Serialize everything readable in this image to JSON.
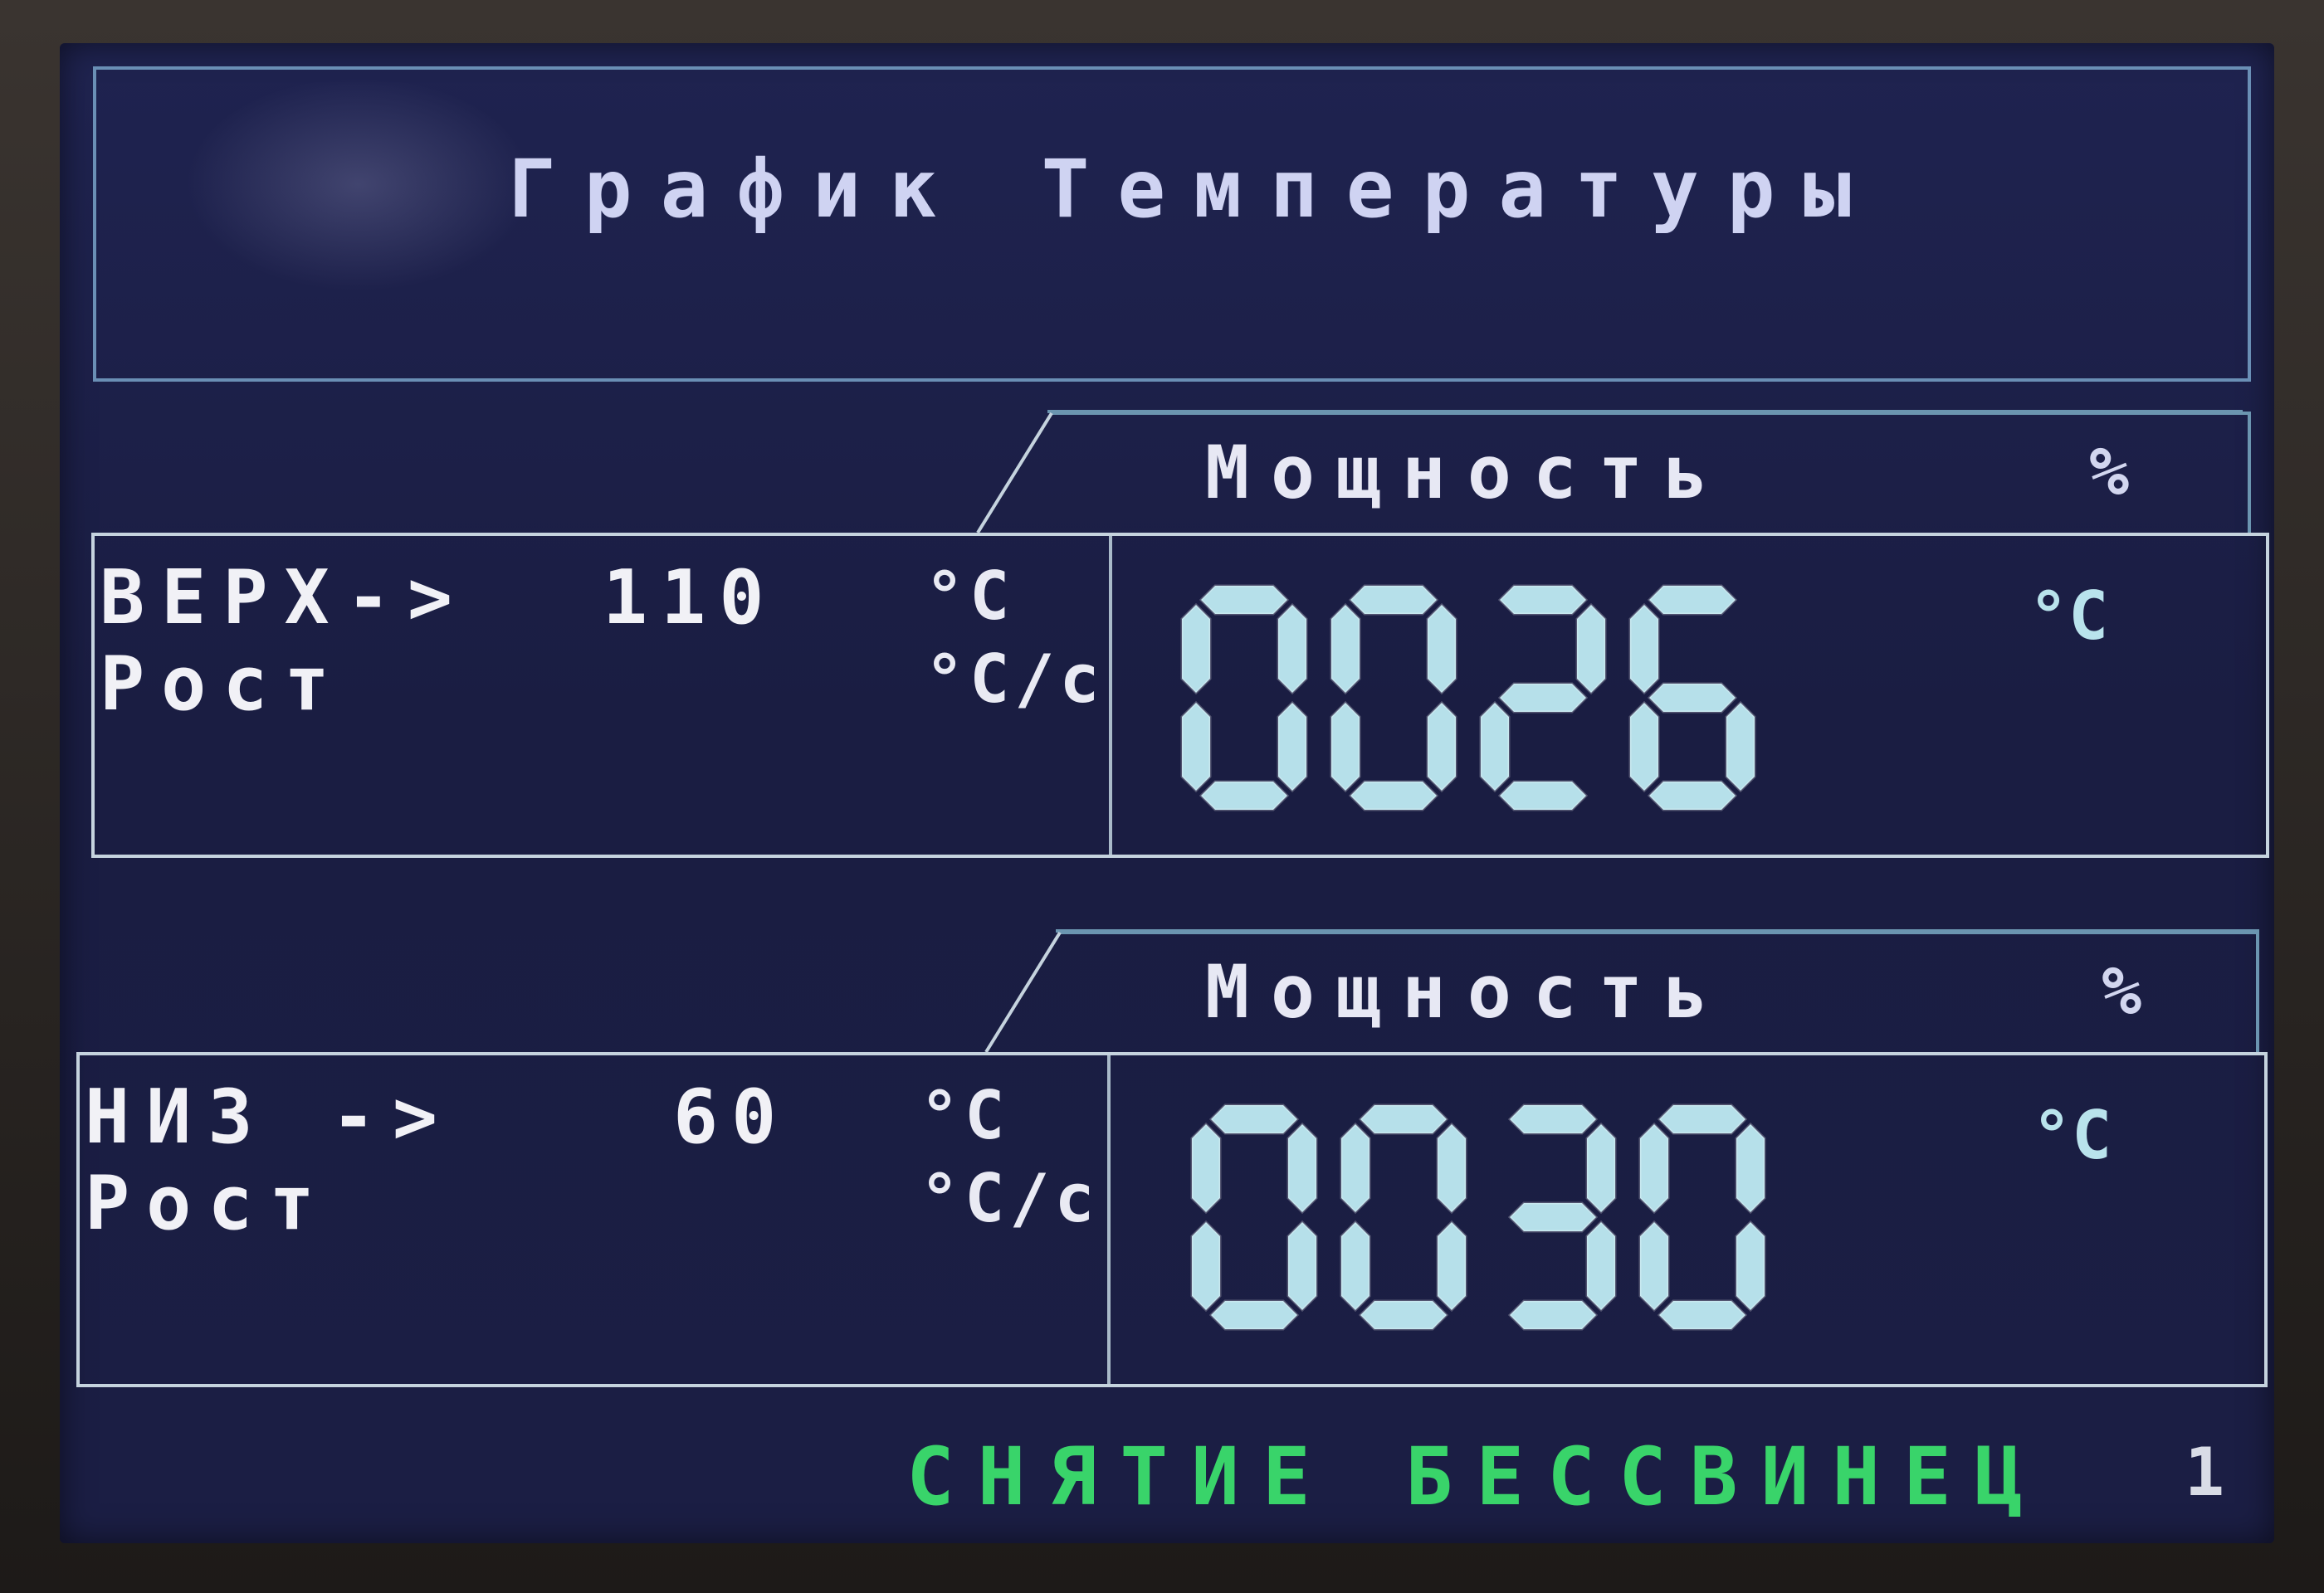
{
  "screen": {
    "title": "График Температуры"
  },
  "zones": [
    {
      "name": "ВЕРХ->",
      "setpoint": "110",
      "setpoint_unit": "°C",
      "rate_label": "Рост",
      "rate_unit": "°C/с",
      "power_label": "Мощность",
      "power_unit": "%",
      "display_value": "0026",
      "display_unit": "°C"
    },
    {
      "name": "НИЗ ->",
      "setpoint": "60",
      "setpoint_unit": "°C",
      "rate_label": "Рост",
      "rate_unit": "°C/с",
      "power_label": "Мощность",
      "power_unit": "%",
      "display_value": "0030",
      "display_unit": "°C"
    }
  ],
  "footer": {
    "status": "СНЯТИЕ БЕССВИНЕЦ",
    "profile_number": "1"
  },
  "colors": {
    "screen_bg": "#1d2048",
    "segment_digits": "#b6e0ea",
    "status_green": "#39d46a",
    "frame_lines": "#c5d3de"
  }
}
